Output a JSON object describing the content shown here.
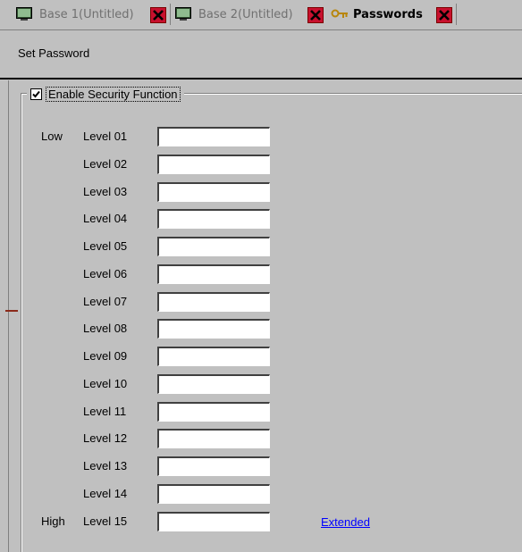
{
  "tabs": [
    {
      "label": "Base 1(Untitled)",
      "icon": "screen-icon",
      "active": false
    },
    {
      "label": "Base 2(Untitled)",
      "icon": "screen-icon",
      "active": false
    },
    {
      "label": "Passwords",
      "icon": "key-icon",
      "active": true
    }
  ],
  "header": {
    "title": "Set Password"
  },
  "security": {
    "enable_label": "Enable Security Function",
    "enabled": true
  },
  "levels": [
    {
      "side": "Low",
      "label": "Level 01",
      "value": ""
    },
    {
      "side": "",
      "label": "Level 02",
      "value": ""
    },
    {
      "side": "",
      "label": "Level 03",
      "value": ""
    },
    {
      "side": "",
      "label": "Level 04",
      "value": ""
    },
    {
      "side": "",
      "label": "Level 05",
      "value": ""
    },
    {
      "side": "",
      "label": "Level 06",
      "value": ""
    },
    {
      "side": "",
      "label": "Level 07",
      "value": ""
    },
    {
      "side": "",
      "label": "Level 08",
      "value": ""
    },
    {
      "side": "",
      "label": "Level 09",
      "value": ""
    },
    {
      "side": "",
      "label": "Level 10",
      "value": ""
    },
    {
      "side": "",
      "label": "Level 11",
      "value": ""
    },
    {
      "side": "",
      "label": "Level 12",
      "value": ""
    },
    {
      "side": "",
      "label": "Level 13",
      "value": ""
    },
    {
      "side": "",
      "label": "Level 14",
      "value": ""
    },
    {
      "side": "High",
      "label": "Level 15",
      "value": ""
    }
  ],
  "extended_link": "Extended",
  "colors": {
    "background": "#c0c0c0",
    "close_button": "#c8102e",
    "link": "#0000ff"
  }
}
